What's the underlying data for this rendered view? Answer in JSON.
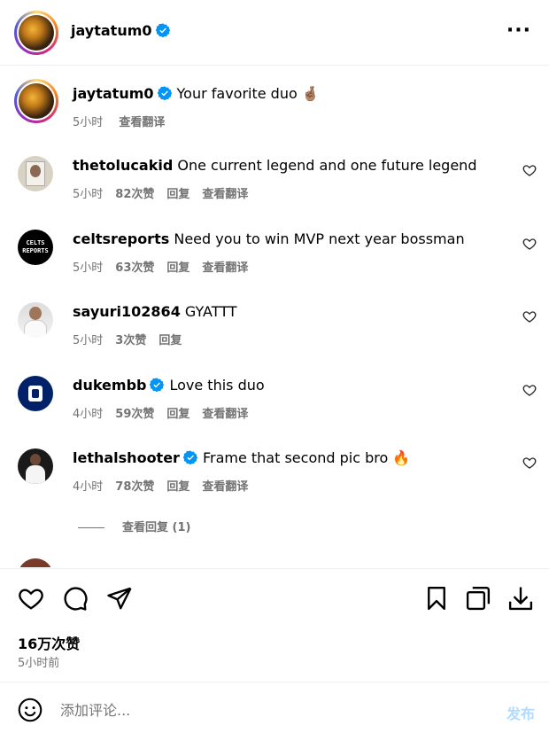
{
  "header": {
    "username": "jaytatum0",
    "more_icon": "more-horizontal-icon"
  },
  "caption": {
    "username": "jaytatum0",
    "text": "Your favorite duo 🤞🏽",
    "time": "5小时",
    "translate": "查看翻译"
  },
  "comments": [
    {
      "username": "thetolucakid",
      "text": "One current legend and one future legend",
      "time": "5小时",
      "likes": "82次赞",
      "reply": "回复",
      "translate": "查看翻译"
    },
    {
      "username": "celtsreports",
      "text": "Need you to win MVP next year bossman",
      "time": "5小时",
      "likes": "63次赞",
      "reply": "回复",
      "translate": "查看翻译",
      "avatar_text": "CELTS REPORTS"
    },
    {
      "username": "sayuri102864",
      "text": "GYATTT",
      "time": "5小时",
      "likes": "3次赞",
      "reply": "回复"
    },
    {
      "username": "dukembb",
      "text": "Love this duo",
      "time": "4小时",
      "likes": "59次赞",
      "reply": "回复",
      "translate": "查看翻译"
    },
    {
      "username": "lethalshooter",
      "text": "Frame that second pic bro 🔥",
      "time": "4小时",
      "likes": "78次赞",
      "reply": "回复",
      "translate": "查看翻译"
    }
  ],
  "view_replies": "查看回复 (1)",
  "footer": {
    "likes": "16万次赞",
    "time": "5小时前"
  },
  "add_comment": {
    "placeholder": "添加评论...",
    "post": "发布"
  },
  "colors": {
    "verified": "#0095f6",
    "muted": "#737373",
    "post_disabled": "#b3dbff"
  }
}
